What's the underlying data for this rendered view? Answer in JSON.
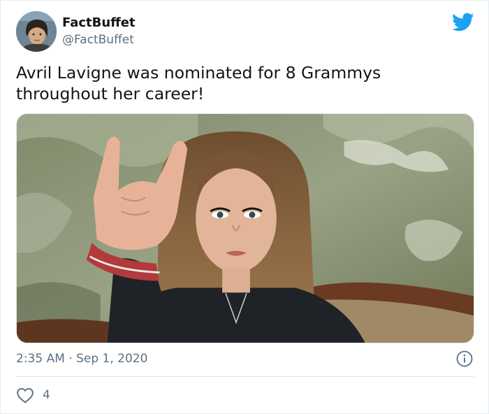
{
  "author": {
    "display_name": "FactBuffet",
    "handle": "@FactBuffet",
    "avatar_label": "FACTBUFFET"
  },
  "tweet": {
    "text": "Avril Lavigne was nominated for 8 Grammys throughout her career!",
    "timestamp": "2:35 AM · Sep 1, 2020",
    "like_count": "4"
  },
  "icons": {
    "brand": "twitter-bird-icon",
    "info": "info-icon",
    "like": "heart-icon"
  },
  "colors": {
    "twitter_blue": "#1da1f2",
    "secondary_text": "#5b7083",
    "primary_text": "#0f1419",
    "divider": "#dfe5ea"
  }
}
